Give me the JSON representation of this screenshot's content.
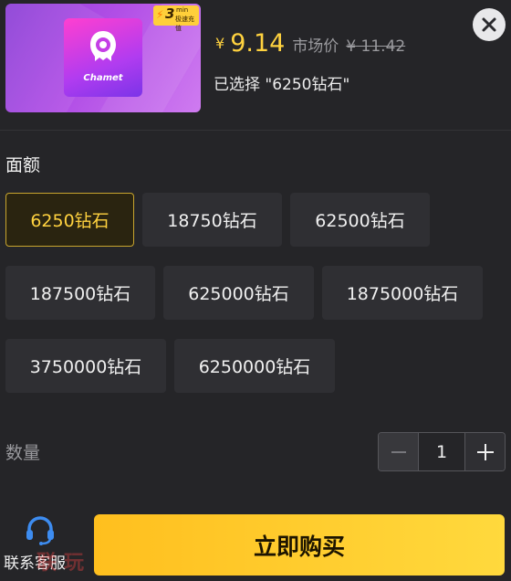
{
  "product": {
    "app_name": "Chamet",
    "badge": {
      "number": "3",
      "unit": "min",
      "text": "极速充值"
    },
    "currency_symbol": "¥",
    "price": "9.14",
    "market_label": "市场价",
    "market_price": "¥ 11.42",
    "selected_text": "已选择 \"6250钻石\""
  },
  "options": {
    "title": "面额",
    "items": [
      {
        "label": "6250钻石",
        "selected": true
      },
      {
        "label": "18750钻石",
        "selected": false
      },
      {
        "label": "62500钻石",
        "selected": false
      },
      {
        "label": "187500钻石",
        "selected": false
      },
      {
        "label": "625000钻石",
        "selected": false
      },
      {
        "label": "1875000钻石",
        "selected": false
      },
      {
        "label": "3750000钻石",
        "selected": false
      },
      {
        "label": "6250000钻石",
        "selected": false
      }
    ]
  },
  "quantity": {
    "label": "数量",
    "value": "1"
  },
  "footer": {
    "support_label": "联系客服",
    "buy_label": "立即购买"
  },
  "watermark": "联玩",
  "colors": {
    "accent": "#ffd23f",
    "background": "#252528",
    "option_bg": "#2f2f33",
    "buy_button": "#ffc72a"
  }
}
